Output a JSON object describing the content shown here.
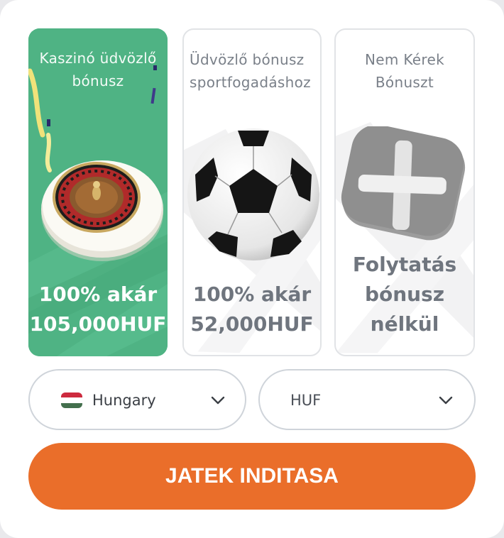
{
  "bonus_cards": [
    {
      "title": "Kaszinó üdvözlő\nbónusz",
      "amount": "100% akár\n105,000HUF",
      "selected": true
    },
    {
      "title": "Üdvözlő bónusz\nsportfogadáshoz",
      "amount": "100% akár\n52,000HUF",
      "selected": false
    },
    {
      "title": "Nem Kérek\nBónuszt",
      "amount": "Folytatás\nbónusz\nnélkül",
      "selected": false
    }
  ],
  "country_select": {
    "value": "Hungary",
    "flag_icon": "hungary-flag-icon",
    "flag_colors": [
      "#cd2a3e",
      "#ffffff",
      "#436f4d"
    ]
  },
  "currency_select": {
    "value": "HUF"
  },
  "cta": {
    "label": "JATEK INDITASA"
  },
  "colors": {
    "accent": "#ea6e2a",
    "casino_green": "#4fb384",
    "border": "#cfd4da"
  }
}
